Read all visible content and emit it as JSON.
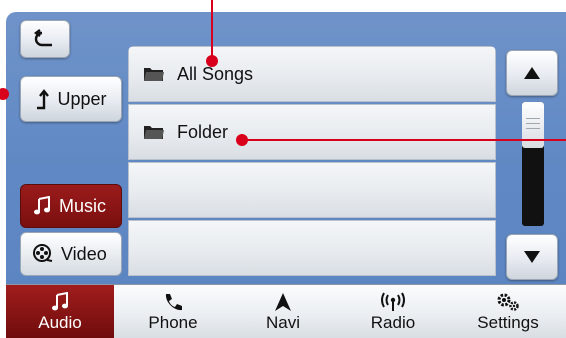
{
  "toolbar": {
    "back_icon": "back-arrow-icon",
    "upper_label": "Upper",
    "upper_icon": "upper-arrow-icon"
  },
  "list": {
    "items": [
      {
        "label": "All Songs",
        "icon": "folder-icon"
      },
      {
        "label": "Folder",
        "icon": "folder-icon"
      },
      {
        "label": ""
      },
      {
        "label": ""
      }
    ]
  },
  "side_tabs": {
    "music_label": "Music",
    "video_label": "Video",
    "selected": "Music"
  },
  "scrollbar": {
    "up_icon": "scroll-up-icon",
    "down_icon": "scroll-down-icon"
  },
  "bottom_nav": {
    "items": [
      {
        "label": "Audio",
        "icon": "music-note-icon",
        "active": true
      },
      {
        "label": "Phone",
        "icon": "phone-icon"
      },
      {
        "label": "Navi",
        "icon": "navi-arrow-icon"
      },
      {
        "label": "Radio",
        "icon": "radio-antenna-icon"
      },
      {
        "label": "Settings",
        "icon": "gear-icon"
      }
    ]
  },
  "colors": {
    "background": "#6f93c9",
    "accent": "#9b1b1b",
    "callout": "#d8001b"
  }
}
